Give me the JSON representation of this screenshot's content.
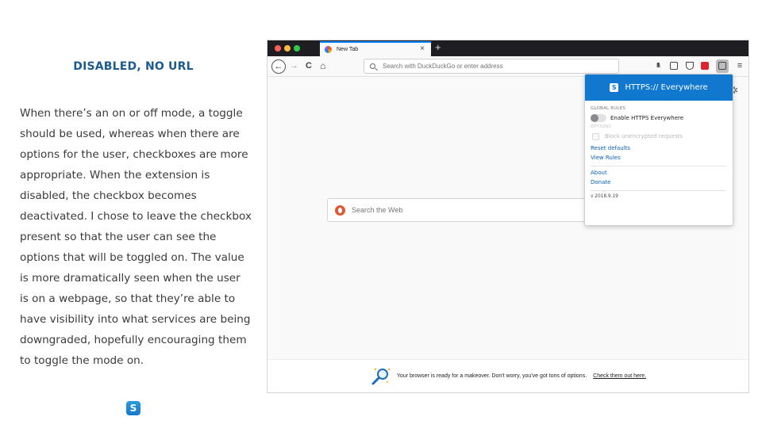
{
  "slide": {
    "title": "DISABLED, NO URL",
    "body": "When there’s an on or off mode, a toggle should be used, whereas when there are options for the user, checkboxes are more appropriate. When the extension is disabled, the checkbox becomes deactivated. I chose to leave the checkbox present so that the user can see the options that will be toggled on. The value is more dramatically seen when the user is on a webpage, so that they’re able to have visibility into what services are being downgraded, hopefully encouraging them to toggle the mode on.",
    "logo_letter": "S"
  },
  "browser": {
    "tab": {
      "title": "New Tab",
      "close": "×"
    },
    "new_tab": "+",
    "nav": {
      "back": "←",
      "forward": "→",
      "reload": "C",
      "home": "⌂"
    },
    "urlbar": {
      "placeholder": "Search with DuckDuckGo or enter address"
    },
    "toolbar": {
      "library": "II\\",
      "menu": "≡"
    },
    "content": {
      "search_placeholder": "Search the Web",
      "gear": "✲"
    },
    "footer": {
      "message": "Your browser is ready for a makeover. Don't worry, you've got tons of options.",
      "link": "Check them out here."
    }
  },
  "popup": {
    "logo_letter": "S",
    "title": "HTTPS:// Everywhere",
    "global_rules_label": "GLOBAL RULES",
    "toggle_label": "Enable HTTPS Everywhere",
    "toggle_on": false,
    "options_label": "OPTIONS",
    "checkbox_label": "Block unencrypted requests",
    "checkbox_checked": false,
    "checkbox_disabled": true,
    "links": {
      "reset": "Reset defaults",
      "view_rules": "View Rules",
      "about": "About",
      "donate": "Donate"
    },
    "version": "v 2018.9.19"
  },
  "colors": {
    "accent": "#1178d0",
    "title": "#1d5a8e",
    "link": "#0a5fc0"
  }
}
